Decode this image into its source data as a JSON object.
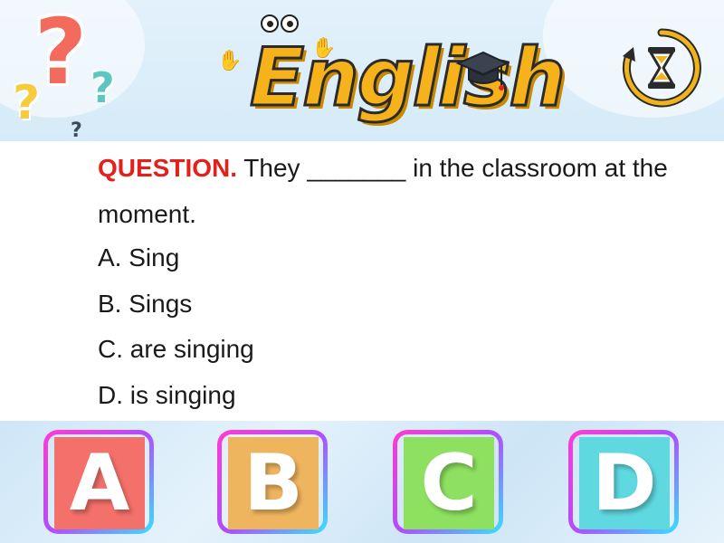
{
  "header": {
    "logo_text": "English",
    "qmark_big": "?",
    "qmark_yellow": "?",
    "qmark_teal": "?",
    "qmark_small": "?"
  },
  "question": {
    "label": "QUESTION.",
    "text": " They _______ in the classroom at the moment."
  },
  "options": [
    {
      "letter": "A",
      "text": "A. Sing"
    },
    {
      "letter": "B",
      "text": "B. Sings"
    },
    {
      "letter": "C",
      "text": "C. are singing"
    },
    {
      "letter": "D",
      "text": "D. is singing"
    }
  ],
  "answers": [
    {
      "letter": "A",
      "color": "#f4706a"
    },
    {
      "letter": "B",
      "color": "#efb45e"
    },
    {
      "letter": "C",
      "color": "#8ee060"
    },
    {
      "letter": "D",
      "color": "#5fd8e0"
    }
  ],
  "colors": {
    "question_label": "#e3201b",
    "logo": "#f6b21a",
    "timer": "#f0b31e"
  },
  "icons": [
    "question-marks-icon",
    "hourglass-timer-icon",
    "graduation-cap-icon"
  ]
}
